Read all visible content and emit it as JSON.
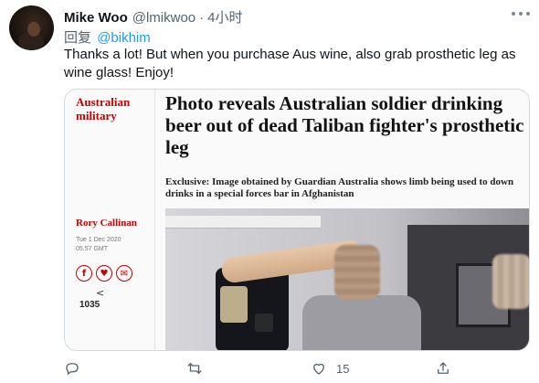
{
  "tweet": {
    "author_name": "Mike Woo",
    "author_handle": "@lmikwoo",
    "separator": "·",
    "time": "4小时",
    "reply_prefix": "回复",
    "reply_mention": "@bikhim",
    "text": "Thanks a lot! But when you purchase Aus wine, also grab prosthetic leg as wine glass! Enjoy!"
  },
  "article": {
    "section": "Australian military",
    "headline": "Photo reveals Australian soldier drinking beer out of dead Taliban fighter's prosthetic leg",
    "standfirst": "Exclusive: Image obtained by Guardian Australia shows limb being used to down drinks in a special forces bar in Afghanistan",
    "byline": "Rory Callinan",
    "dateline": "Tue 1 Dec 2020 05.57 GMT",
    "share_buttons": [
      "f",
      "♥",
      "✉"
    ],
    "share_glyph": "<",
    "share_count": "1035"
  },
  "actions": {
    "like_count": "15"
  },
  "icons": {
    "more": "more-icon",
    "reply": "reply-icon",
    "retweet": "retweet-icon",
    "like": "heart-icon",
    "share": "share-icon"
  },
  "colors": {
    "link": "#1d9bf0",
    "guardian_red": "#c70000",
    "muted": "#536471"
  }
}
